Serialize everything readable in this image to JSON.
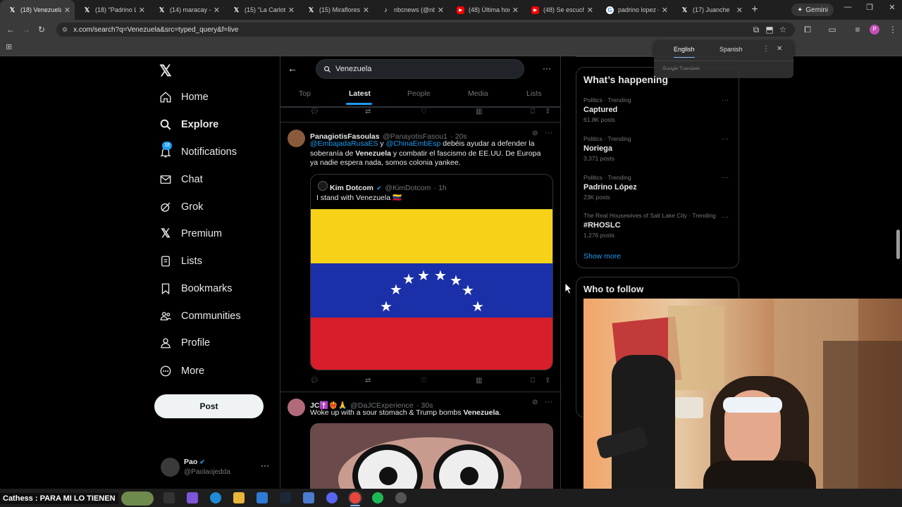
{
  "browser": {
    "tabs": [
      {
        "title": "(18) Venezuela",
        "icon": "x-logo-icon",
        "active": true
      },
      {
        "title": "(18) \"Padrino Ló...",
        "icon": "x-logo-icon"
      },
      {
        "title": "(14) maracay - S...",
        "icon": "x-logo-icon"
      },
      {
        "title": "(15) \"La Carlota\"...",
        "icon": "x-logo-icon"
      },
      {
        "title": "(15) Miraflores -...",
        "icon": "x-logo-icon"
      },
      {
        "title": "nbcnews (@nbc...",
        "icon": "tiktok-icon"
      },
      {
        "title": "(48) Última hora...",
        "icon": "youtube-icon"
      },
      {
        "title": "(48) Se escuchan...",
        "icon": "youtube-icon"
      },
      {
        "title": "padrino lopez - ...",
        "icon": "google-icon"
      },
      {
        "title": "(17) Juanche",
        "icon": "x-logo-icon"
      }
    ],
    "gemini_label": "Gemini",
    "url": "x.com/search?q=Venezuela&src=typed_query&f=live"
  },
  "translate": {
    "lang_a": "English",
    "lang_b": "Spanish",
    "brand": "Google Translate"
  },
  "nav": {
    "items": [
      {
        "label": "Home",
        "icon": "home-icon"
      },
      {
        "label": "Explore",
        "icon": "search-icon"
      },
      {
        "label": "Notifications",
        "icon": "bell-icon",
        "badge": "18"
      },
      {
        "label": "Chat",
        "icon": "mail-icon"
      },
      {
        "label": "Grok",
        "icon": "grok-icon"
      },
      {
        "label": "Premium",
        "icon": "x-premium-icon"
      },
      {
        "label": "Lists",
        "icon": "list-icon"
      },
      {
        "label": "Bookmarks",
        "icon": "bookmark-icon"
      },
      {
        "label": "Communities",
        "icon": "communities-icon"
      },
      {
        "label": "Profile",
        "icon": "person-icon"
      },
      {
        "label": "More",
        "icon": "more-circle-icon"
      }
    ],
    "post_button": "Post",
    "account": {
      "name": "Pao",
      "handle": "@Paolaojedda"
    }
  },
  "feed": {
    "search_value": "Venezuela",
    "tabs": [
      "Top",
      "Latest",
      "People",
      "Media",
      "Lists"
    ],
    "active_tab": "Latest",
    "tweet1": {
      "name": "PanagiotisFasoulas",
      "handle": "@PanayotisFasou1",
      "time": "· 20s",
      "mention_a": "@EmbajadaRusaES",
      "join": " y ",
      "mention_b": "@ChinaEmbEsp",
      "text_a": " debéis ayudar a defender la soberanía de ",
      "bold_word": "Venezuela",
      "text_b": " y combatir el fascismo de EE.UU. De Europa ya nadie espera nada, somos colonia yankee.",
      "quote": {
        "name": "Kim Dotcom",
        "handle": "@KimDotcom",
        "time": "· 1h",
        "text": "I stand with Venezuela 🇻🇪"
      }
    },
    "tweet2": {
      "name": "JC✝️❤️‍🔥🙏",
      "handle": "@DaJCExperience",
      "time": "· 30s",
      "text_a": "Woke up with a sour stomach & Trump bombs ",
      "bold_word": "Venezuela",
      "text_b": "."
    }
  },
  "trends": {
    "title": "What’s happening",
    "items": [
      {
        "category": "Politics · Trending",
        "name": "Captured",
        "count": "61.8K posts"
      },
      {
        "category": "Politics · Trending",
        "name": "Noriega",
        "count": "3,371 posts"
      },
      {
        "category": "Politics · Trending",
        "name": "Padrino López",
        "count": "23K posts"
      },
      {
        "category": "The Real Housewives of Salt Lake City · Trending",
        "name": "#RHOSLC",
        "count": "1,276 posts"
      }
    ],
    "show_more": "Show more",
    "who_to_follow": "Who to follow"
  },
  "stream": {
    "ticker": "Cathess : PARA MI LO TIENEN"
  },
  "colors": {
    "accent": "#1d9bf0",
    "flag_yellow": "#f7d117",
    "flag_blue": "#1a2fa8",
    "flag_red": "#d81e2a"
  }
}
